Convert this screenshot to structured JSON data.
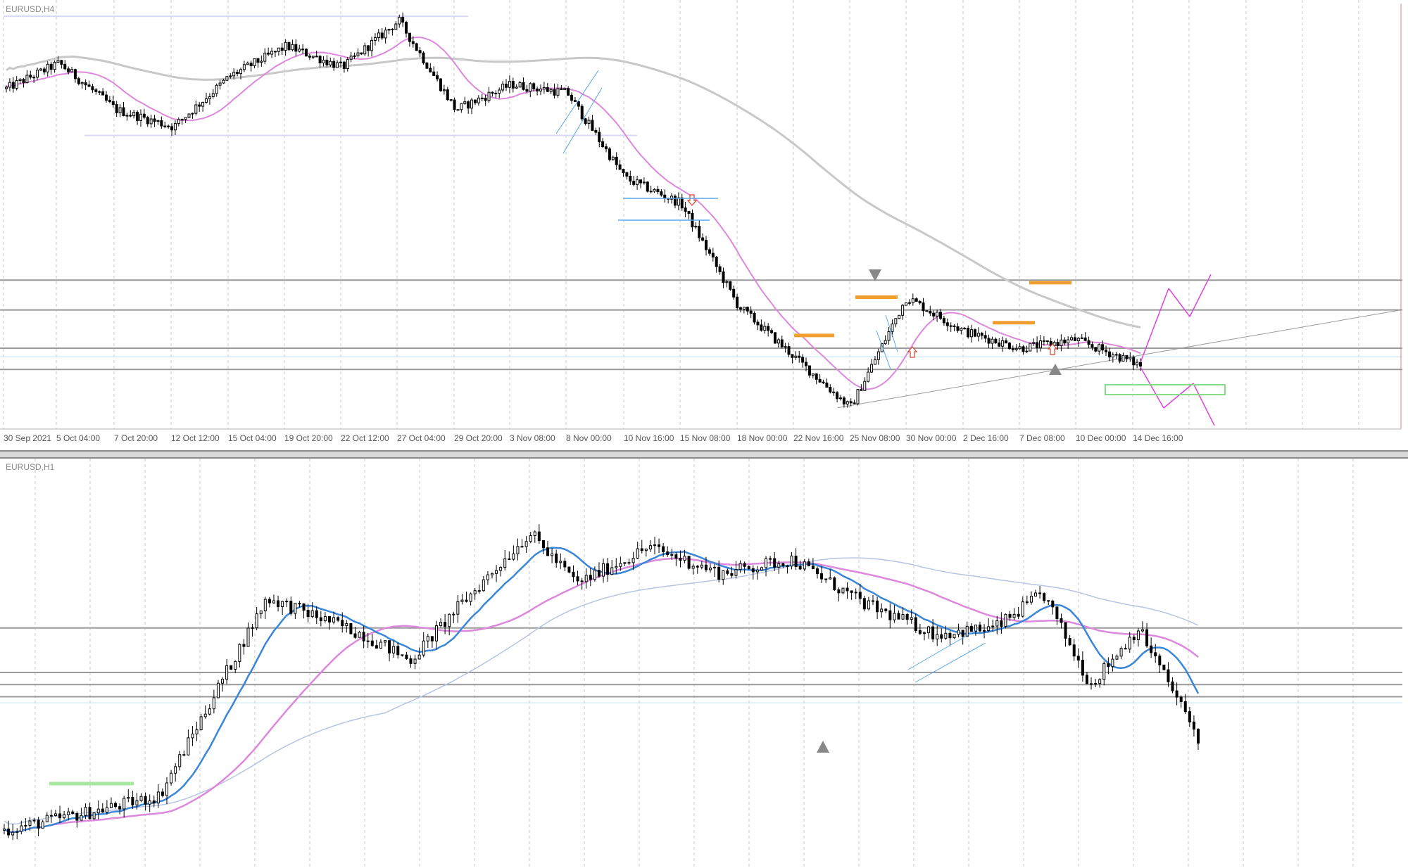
{
  "window": {
    "top_symbol": "EURUSD,H4",
    "bottom_symbol": "EURUSD,H1"
  },
  "colors": {
    "background": "#ffffff",
    "candle": "#000000",
    "ma_fast_h4": "#dd88dd",
    "ma_slow_h4": "#c8c8c8",
    "ma_fast_h1": "#3a86d8",
    "ma_mid_h1": "#dd88dd",
    "ma_slow_h1": "#b8c4e0",
    "level_line": "#9a9a9a",
    "price_line": "#bfe3ef",
    "zone_orange": "#f0a030",
    "projection": "#dd44dd",
    "box_green": "#88dd88",
    "channel_blue": "#5aa8e8"
  },
  "chart_data": [
    {
      "type": "candlestick",
      "title": "EURUSD,H4",
      "time_axis_labels": [
        "30 Sep 2021",
        "5 Oct 04:00",
        "7 Oct 20:00",
        "12 Oct 12:00",
        "15 Oct 04:00",
        "19 Oct 20:00",
        "22 Oct 12:00",
        "27 Oct 04:00",
        "29 Oct 20:00",
        "3 Nov 08:00",
        "8 Nov 00:00",
        "10 Nov 16:00",
        "15 Nov 08:00",
        "18 Nov 00:00",
        "22 Nov 16:00",
        "25 Nov 08:00",
        "30 Nov 00:00",
        "2 Dec 16:00",
        "7 Dec 08:00",
        "10 Dec 00:00",
        "14 Dec 16:00"
      ],
      "ylim": [
        1.118,
        1.168
      ],
      "ohlc_anchors": [
        {
          "x": "30 Sep 2021",
          "close": 1.158
        },
        {
          "x": "5 Oct 04:00",
          "close": 1.161
        },
        {
          "x": "7 Oct 20:00",
          "close": 1.1555
        },
        {
          "x": "12 Oct 12:00",
          "close": 1.1535
        },
        {
          "x": "15 Oct 04:00",
          "close": 1.1595
        },
        {
          "x": "19 Oct 20:00",
          "close": 1.163
        },
        {
          "x": "22 Oct 12:00",
          "close": 1.1605
        },
        {
          "x": "27 Oct 04:00",
          "close": 1.166
        },
        {
          "x": "29 Oct 20:00",
          "close": 1.1555
        },
        {
          "x": "3 Nov 08:00",
          "close": 1.1585
        },
        {
          "x": "8 Nov 00:00",
          "close": 1.1575
        },
        {
          "x": "10 Nov 16:00",
          "close": 1.1475
        },
        {
          "x": "15 Nov 08:00",
          "close": 1.1445
        },
        {
          "x": "18 Nov 00:00",
          "close": 1.1325
        },
        {
          "x": "22 Nov 16:00",
          "close": 1.1265
        },
        {
          "x": "25 Nov 08:00",
          "close": 1.1205
        },
        {
          "x": "30 Nov 00:00",
          "close": 1.1335
        },
        {
          "x": "2 Dec 16:00",
          "close": 1.1295
        },
        {
          "x": "7 Dec 08:00",
          "close": 1.1275
        },
        {
          "x": "10 Dec 00:00",
          "close": 1.1285
        },
        {
          "x": "14 Dec 16:00",
          "close": 1.1255
        }
      ],
      "horizontal_levels": [
        1.1355,
        1.132,
        1.1275,
        1.125
      ],
      "current_price": 1.1265
    },
    {
      "type": "candlestick",
      "title": "EURUSD,H1",
      "ylim": [
        1.12,
        1.14
      ],
      "ohlc_anchors_by_fraction": [
        {
          "t": 0.0,
          "close": 1.1218
        },
        {
          "t": 0.08,
          "close": 1.1228
        },
        {
          "t": 0.13,
          "close": 1.1235
        },
        {
          "t": 0.22,
          "close": 1.1333
        },
        {
          "t": 0.3,
          "close": 1.1315
        },
        {
          "t": 0.34,
          "close": 1.1302
        },
        {
          "t": 0.38,
          "close": 1.1328
        },
        {
          "t": 0.44,
          "close": 1.1365
        },
        {
          "t": 0.48,
          "close": 1.134
        },
        {
          "t": 0.54,
          "close": 1.1358
        },
        {
          "t": 0.6,
          "close": 1.1345
        },
        {
          "t": 0.66,
          "close": 1.1352
        },
        {
          "t": 0.72,
          "close": 1.133
        },
        {
          "t": 0.78,
          "close": 1.1315
        },
        {
          "t": 0.83,
          "close": 1.1318
        },
        {
          "t": 0.87,
          "close": 1.1335
        },
        {
          "t": 0.91,
          "close": 1.129
        },
        {
          "t": 0.95,
          "close": 1.1318
        },
        {
          "t": 1.0,
          "close": 1.1264
        }
      ],
      "horizontal_levels": [
        1.1318,
        1.1296,
        1.129,
        1.1284
      ],
      "current_price": 1.1281
    }
  ]
}
